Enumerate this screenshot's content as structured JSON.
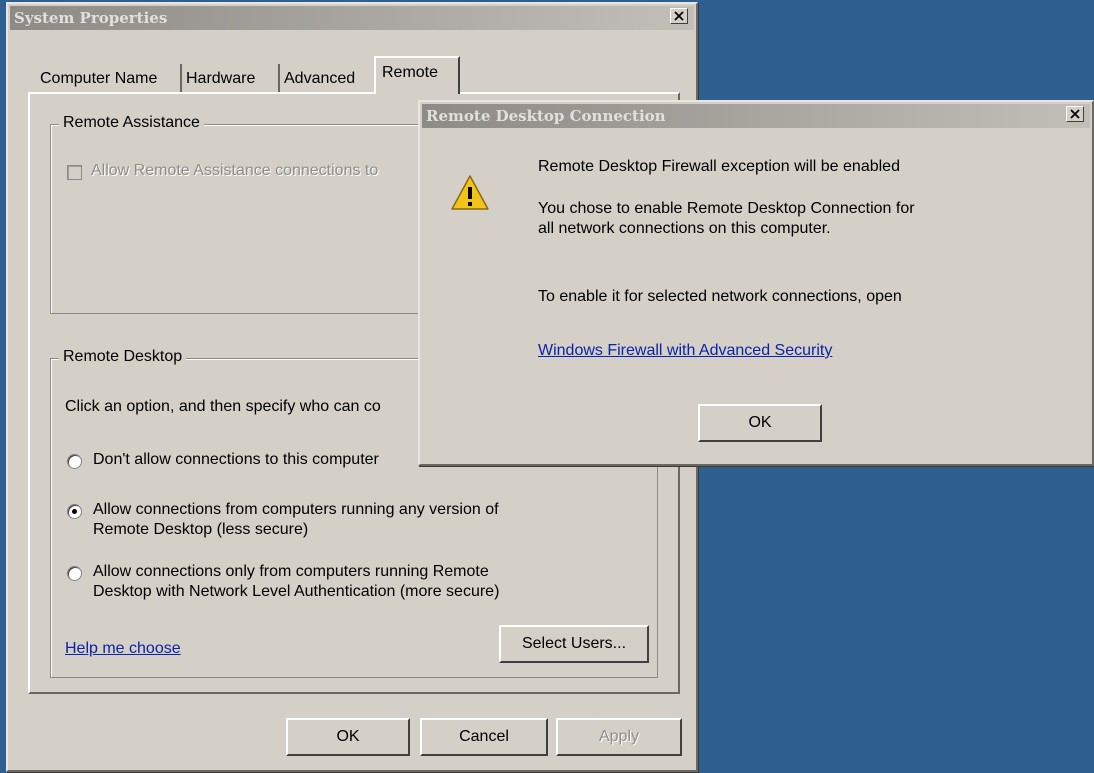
{
  "system_properties": {
    "title": "System Properties",
    "tabs": [
      "Computer Name",
      "Hardware",
      "Advanced",
      "Remote"
    ],
    "active_tab": "Remote",
    "remote_assistance": {
      "legend": "Remote Assistance",
      "checkbox_label": "Allow Remote Assistance connections to",
      "checked": false,
      "enabled": false
    },
    "remote_desktop": {
      "legend": "Remote Desktop",
      "instruction": "Click an option, and then specify who can co",
      "options": [
        {
          "line1": "Don't allow connections to this computer",
          "line2": "",
          "selected": false
        },
        {
          "line1": "Allow connections from computers running any version of",
          "line2": "Remote Desktop (less secure)",
          "selected": true
        },
        {
          "line1": "Allow connections only from computers running Remote",
          "line2": "Desktop with Network Level Authentication (more secure)",
          "selected": false
        }
      ],
      "help_link": "Help me choose",
      "select_users": "Select Users..."
    },
    "buttons": {
      "ok": "OK",
      "cancel": "Cancel",
      "apply": "Apply"
    }
  },
  "rdc_dialog": {
    "title": "Remote Desktop Connection",
    "icon": "warning-icon",
    "heading": "Remote Desktop Firewall exception will be enabled",
    "message_line1": "You chose to enable Remote Desktop Connection for",
    "message_line2": "all network connections on this computer.",
    "instruction": "To enable it for selected network connections, open",
    "link": "Windows Firewall with Advanced Security",
    "ok": "OK"
  },
  "colors": {
    "desktop": "#2f5f91",
    "dialog_face": "#d4d0c8",
    "link": "#0b23a6",
    "warning": "#f2c318"
  }
}
